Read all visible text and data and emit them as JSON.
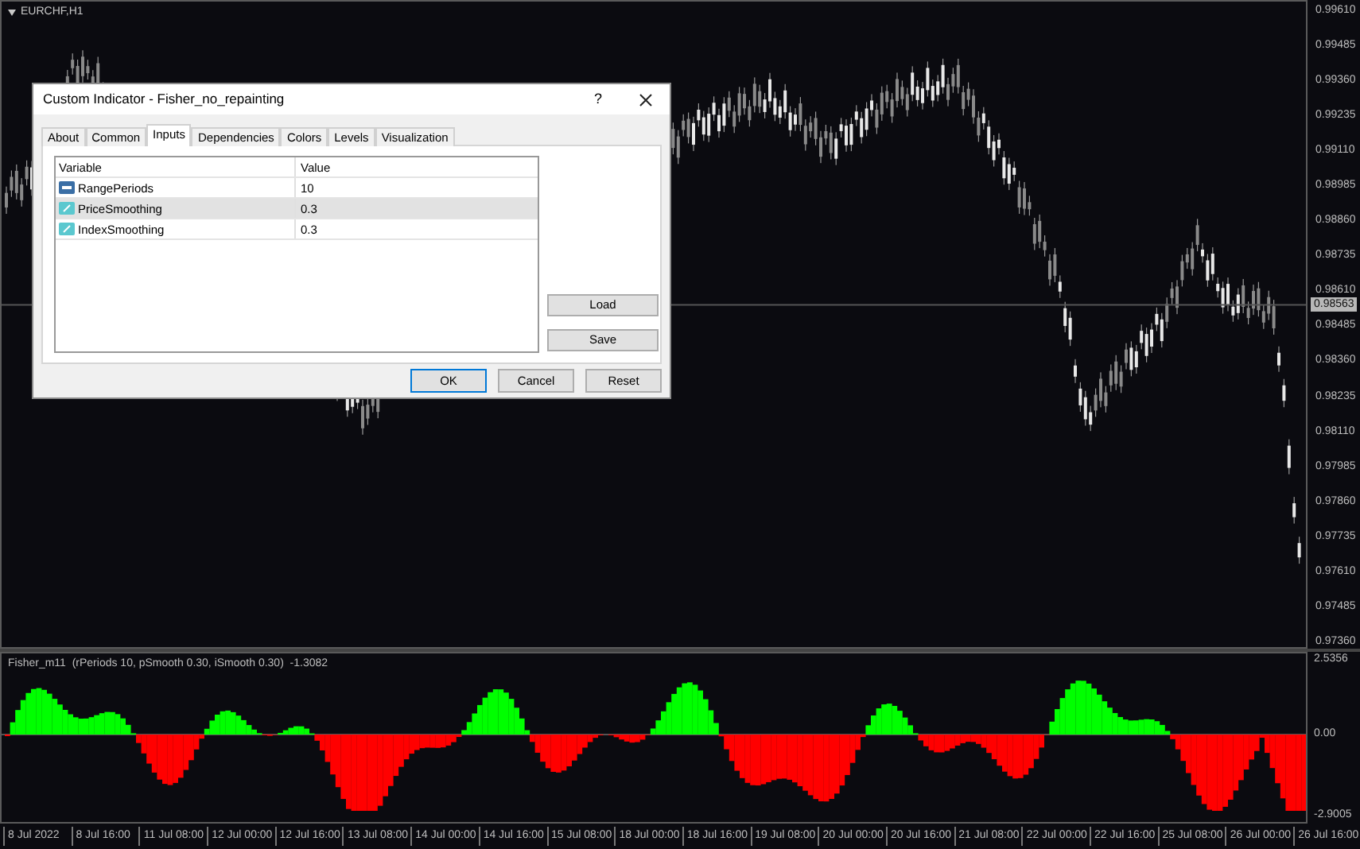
{
  "chart": {
    "title": "EURCHF,H1",
    "price_labels": [
      "0.99610",
      "0.99485",
      "0.99360",
      "0.99235",
      "0.99110",
      "0.98985",
      "0.98860",
      "0.98735",
      "0.98610",
      "0.98485",
      "0.98360",
      "0.98235",
      "0.98110",
      "0.97985",
      "0.97860",
      "0.97735",
      "0.97610",
      "0.97485",
      "0.97360"
    ],
    "current_price": "0.98563"
  },
  "indicator": {
    "label": "Fisher_m11  (rPeriods 10, pSmooth 0.30, iSmooth 0.30)  -1.3082",
    "axis_labels": [
      "2.5356",
      "0.00",
      "-2.9005"
    ]
  },
  "time_labels": [
    "8 Jul 2022",
    "8 Jul 16:00",
    "11 Jul 08:00",
    "12 Jul 00:00",
    "12 Jul 16:00",
    "13 Jul 08:00",
    "14 Jul 00:00",
    "14 Jul 16:00",
    "15 Jul 08:00",
    "18 Jul 00:00",
    "18 Jul 16:00",
    "19 Jul 08:00",
    "20 Jul 00:00",
    "20 Jul 16:00",
    "21 Jul 08:00",
    "22 Jul 00:00",
    "22 Jul 16:00",
    "25 Jul 08:00",
    "26 Jul 00:00",
    "26 Jul 16:00"
  ],
  "dialog": {
    "title": "Custom Indicator - Fisher_no_repainting",
    "help": "?",
    "tabs": [
      {
        "label": "About",
        "selected": false
      },
      {
        "label": "Common",
        "selected": false
      },
      {
        "label": "Inputs",
        "selected": true
      },
      {
        "label": "Dependencies",
        "selected": false
      },
      {
        "label": "Colors",
        "selected": false
      },
      {
        "label": "Levels",
        "selected": false
      },
      {
        "label": "Visualization",
        "selected": false
      }
    ],
    "columns": [
      "Variable",
      "Value"
    ],
    "rows": [
      {
        "kind": "integer",
        "variable": "RangePeriods",
        "value": "10",
        "selected": false
      },
      {
        "kind": "double",
        "variable": "PriceSmoothing",
        "value": "0.3",
        "selected": true
      },
      {
        "kind": "double",
        "variable": "IndexSmoothing",
        "value": "0.3",
        "selected": false
      }
    ],
    "side_buttons": [
      "Load",
      "Save"
    ],
    "buttons": [
      {
        "label": "OK",
        "default": true
      },
      {
        "label": "Cancel",
        "default": false
      },
      {
        "label": "Reset",
        "default": false
      }
    ]
  }
}
